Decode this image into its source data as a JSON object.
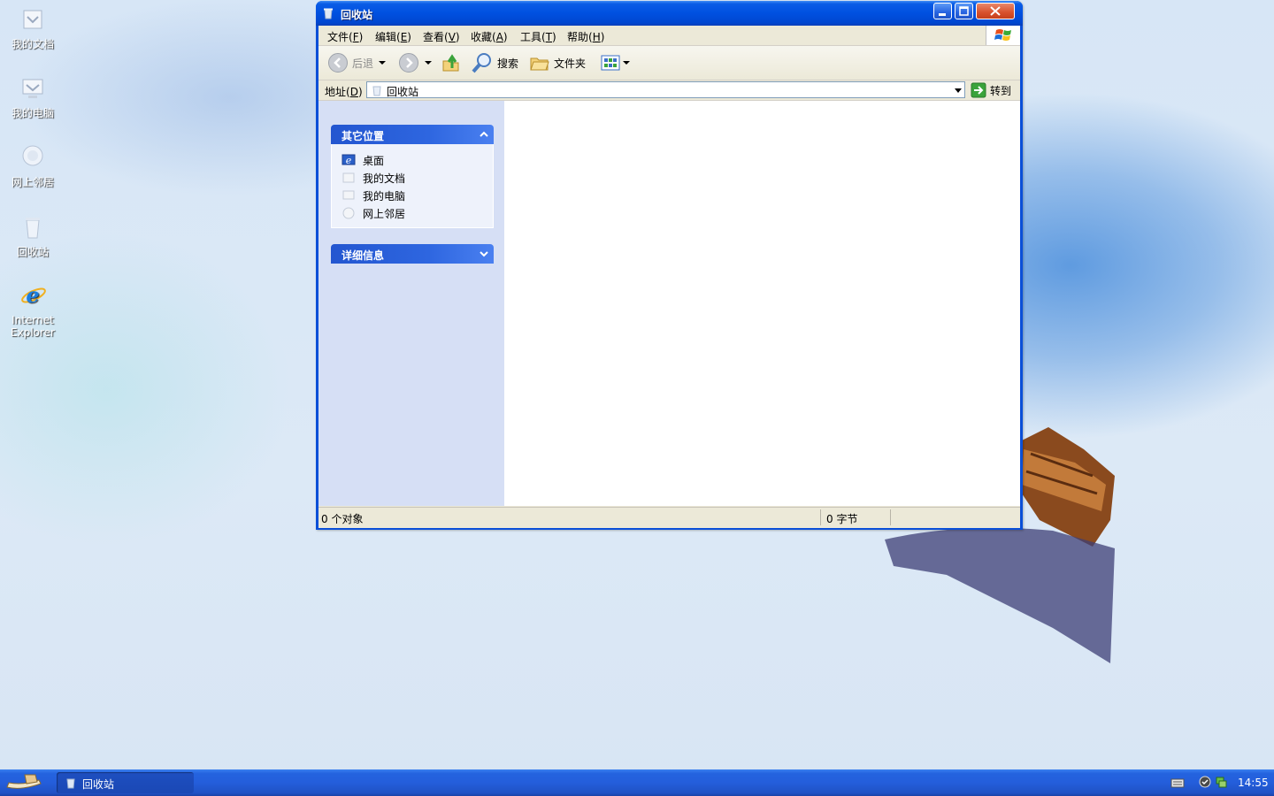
{
  "desktop": {
    "icons": [
      {
        "label": "我的文档"
      },
      {
        "label": "我的电脑"
      },
      {
        "label": "网上邻居"
      },
      {
        "label": "回收站"
      },
      {
        "label_line1": "Internet",
        "label_line2": "Explorer"
      }
    ]
  },
  "window": {
    "title": "回收站",
    "menu": [
      {
        "label": "文件(",
        "acc": "F",
        "tail": ")"
      },
      {
        "label": "编辑(",
        "acc": "E",
        "tail": ")"
      },
      {
        "label": "查看(",
        "acc": "V",
        "tail": ")"
      },
      {
        "label": "收藏(",
        "acc": "A",
        "tail": ")"
      },
      {
        "label": "工具(",
        "acc": "T",
        "tail": ")"
      },
      {
        "label": "帮助(",
        "acc": "H",
        "tail": ")"
      }
    ],
    "toolbar": {
      "back_label": "后退",
      "search_label": "搜索",
      "folders_label": "文件夹"
    },
    "address": {
      "label": "地址(",
      "acc": "D",
      "tail": ")",
      "value": "回收站",
      "go_label": "转到"
    },
    "taskpane": {
      "other_places": {
        "title": "其它位置",
        "items": [
          "桌面",
          "我的文档",
          "我的电脑",
          "网上邻居"
        ]
      },
      "details": {
        "title": "详细信息"
      }
    },
    "status": {
      "objects": "0 个对象",
      "size": "0 字节"
    }
  },
  "taskbar": {
    "task_label": "回收站",
    "clock": "14:55"
  },
  "colors": {
    "xp_blue": "#0050e0",
    "taskpane_header": "#2e66e0",
    "taskbar": "#245edb"
  }
}
